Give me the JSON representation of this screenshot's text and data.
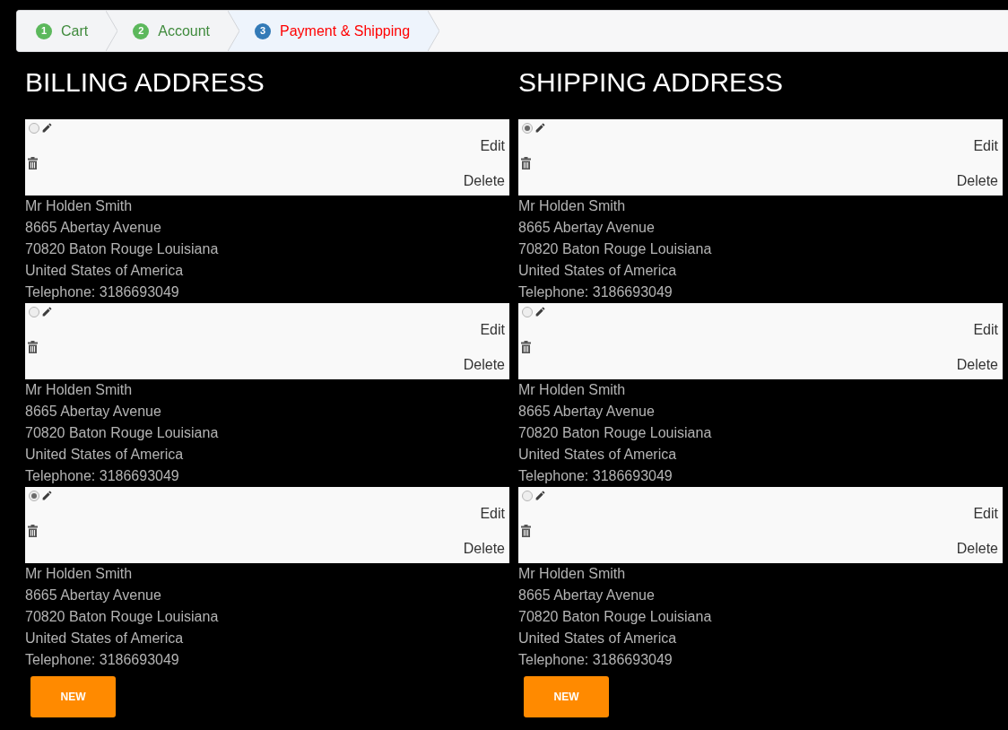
{
  "breadcrumb": [
    {
      "number": "1",
      "label": "Cart",
      "selected": false
    },
    {
      "number": "2",
      "label": "Account",
      "selected": false
    },
    {
      "number": "3",
      "label": "Payment & Shipping",
      "selected": true
    }
  ],
  "sections": [
    {
      "title": "BILLING ADDRESS",
      "addresses": [
        {
          "selected": false,
          "edit": "Edit",
          "delete": "Delete",
          "lines": [
            "Mr Holden Smith",
            "8665 Abertay Avenue",
            "70820 Baton Rouge Louisiana",
            "United States of America",
            "Telephone: 3186693049"
          ]
        },
        {
          "selected": false,
          "edit": "Edit",
          "delete": "Delete",
          "lines": [
            "Mr Holden Smith",
            "8665 Abertay Avenue",
            "70820 Baton Rouge Louisiana",
            "United States of America",
            "Telephone: 3186693049"
          ]
        },
        {
          "selected": true,
          "edit": "Edit",
          "delete": "Delete",
          "lines": [
            "Mr Holden Smith",
            "8665 Abertay Avenue",
            "70820 Baton Rouge Louisiana",
            "United States of America",
            "Telephone: 3186693049"
          ]
        }
      ],
      "new_button": "NEW"
    },
    {
      "title": "SHIPPING ADDRESS",
      "addresses": [
        {
          "selected": true,
          "edit": "Edit",
          "delete": "Delete",
          "lines": [
            "Mr Holden Smith",
            "8665 Abertay Avenue",
            "70820 Baton Rouge Louisiana",
            "United States of America",
            "Telephone: 3186693049"
          ]
        },
        {
          "selected": false,
          "edit": "Edit",
          "delete": "Delete",
          "lines": [
            "Mr Holden Smith",
            "8665 Abertay Avenue",
            "70820 Baton Rouge Louisiana",
            "United States of America",
            "Telephone: 3186693049"
          ]
        },
        {
          "selected": false,
          "edit": "Edit",
          "delete": "Delete",
          "lines": [
            "Mr Holden Smith",
            "8665 Abertay Avenue",
            "70820 Baton Rouge Louisiana",
            "United States of America",
            "Telephone: 3186693049"
          ]
        }
      ],
      "new_button": "NEW"
    }
  ]
}
